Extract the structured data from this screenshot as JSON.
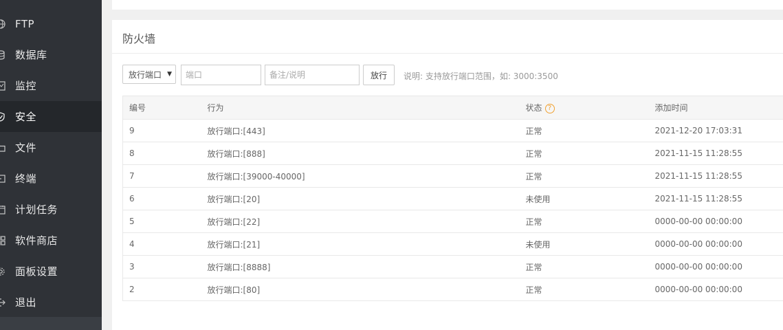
{
  "sidebar": {
    "items": [
      {
        "label": "FTP",
        "icon": "globe-icon",
        "name": "sidebar-item-ftp"
      },
      {
        "label": "数据库",
        "icon": "database-icon",
        "name": "sidebar-item-database"
      },
      {
        "label": "监控",
        "icon": "monitor-icon",
        "name": "sidebar-item-monitor"
      },
      {
        "label": "安全",
        "icon": "shield-icon",
        "name": "sidebar-item-security"
      },
      {
        "label": "文件",
        "icon": "folder-icon",
        "name": "sidebar-item-files"
      },
      {
        "label": "终端",
        "icon": "terminal-icon",
        "name": "sidebar-item-terminal"
      },
      {
        "label": "计划任务",
        "icon": "calendar-icon",
        "name": "sidebar-item-cron"
      },
      {
        "label": "软件商店",
        "icon": "grid-icon",
        "name": "sidebar-item-store"
      },
      {
        "label": "面板设置",
        "icon": "gear-icon",
        "name": "sidebar-item-settings"
      },
      {
        "label": "退出",
        "icon": "logout-icon",
        "name": "sidebar-item-logout"
      }
    ],
    "active_index": 3
  },
  "firewall": {
    "title": "防火墙",
    "select_value": "放行端口",
    "port_placeholder": "端口",
    "note_placeholder": "备注/说明",
    "submit_label": "放行",
    "hint": "说明: 支持放行端口范围，如: 3000:3500"
  },
  "table": {
    "headers": {
      "id": "编号",
      "action": "行为",
      "status": "状态",
      "time": "添加时间"
    },
    "help_glyph": "?",
    "rows": [
      {
        "id": "9",
        "action": "放行端口:[443]",
        "status": "正常",
        "time": "2021-12-20 17:03:31"
      },
      {
        "id": "8",
        "action": "放行端口:[888]",
        "status": "正常",
        "time": "2021-11-15 11:28:55"
      },
      {
        "id": "7",
        "action": "放行端口:[39000-40000]",
        "status": "正常",
        "time": "2021-11-15 11:28:55"
      },
      {
        "id": "6",
        "action": "放行端口:[20]",
        "status": "未使用",
        "time": "2021-11-15 11:28:55"
      },
      {
        "id": "5",
        "action": "放行端口:[22]",
        "status": "正常",
        "time": "0000-00-00 00:00:00"
      },
      {
        "id": "4",
        "action": "放行端口:[21]",
        "status": "未使用",
        "time": "0000-00-00 00:00:00"
      },
      {
        "id": "3",
        "action": "放行端口:[8888]",
        "status": "正常",
        "time": "0000-00-00 00:00:00"
      },
      {
        "id": "2",
        "action": "放行端口:[80]",
        "status": "正常",
        "time": "0000-00-00 00:00:00"
      }
    ]
  },
  "colors": {
    "sidebar_bg": "#2f3237",
    "sidebar_active_bg": "#24272b",
    "help_accent": "#f0a030"
  }
}
